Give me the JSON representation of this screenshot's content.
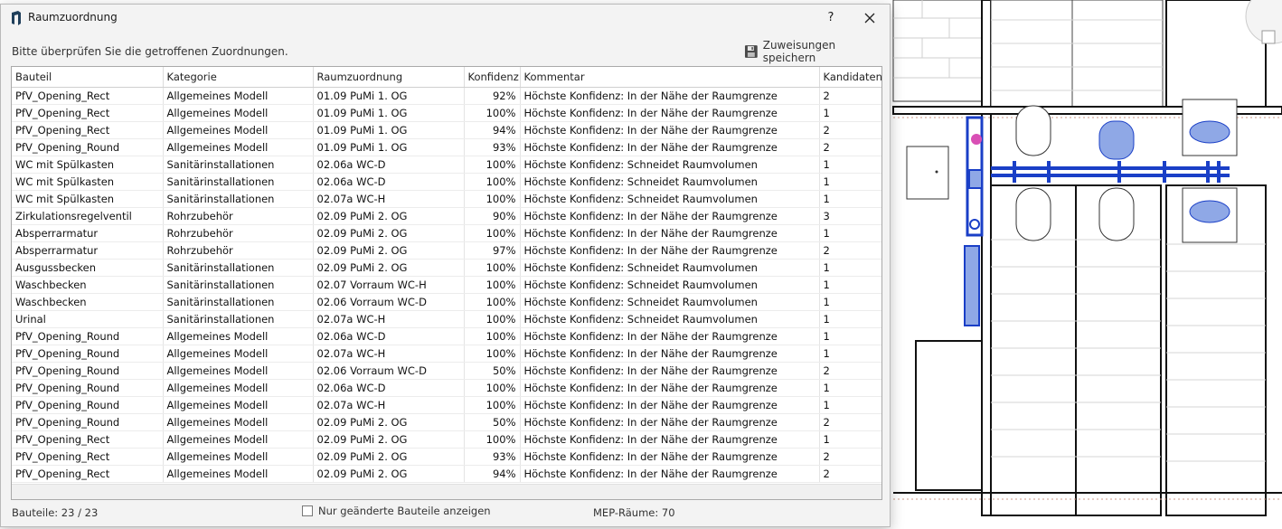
{
  "window": {
    "title": "Raumzuordnung",
    "help": "?"
  },
  "instruction": "Bitte überprüfen Sie die getroffenen Zuordnungen.",
  "save_label": "Zuweisungen speichern",
  "columns": [
    "Bauteil",
    "Kategorie",
    "Raumzuordnung",
    "Konfidenz",
    "Kommentar",
    "Kandidaten"
  ],
  "rows": [
    [
      "PfV_Opening_Rect",
      "Allgemeines Modell",
      "01.09 PuMi 1. OG",
      "92%",
      "Höchste Konfidenz: In der Nähe der Raumgrenze",
      "2"
    ],
    [
      "PfV_Opening_Rect",
      "Allgemeines Modell",
      "01.09 PuMi 1. OG",
      "100%",
      "Höchste Konfidenz: In der Nähe der Raumgrenze",
      "1"
    ],
    [
      "PfV_Opening_Rect",
      "Allgemeines Modell",
      "01.09 PuMi 1. OG",
      "94%",
      "Höchste Konfidenz: In der Nähe der Raumgrenze",
      "2"
    ],
    [
      "PfV_Opening_Round",
      "Allgemeines Modell",
      "01.09 PuMi 1. OG",
      "93%",
      "Höchste Konfidenz: In der Nähe der Raumgrenze",
      "2"
    ],
    [
      "WC mit Spülkasten",
      "Sanitärinstallationen",
      "02.06a WC-D",
      "100%",
      "Höchste Konfidenz: Schneidet Raumvolumen",
      "1"
    ],
    [
      "WC mit Spülkasten",
      "Sanitärinstallationen",
      "02.06a WC-D",
      "100%",
      "Höchste Konfidenz: Schneidet Raumvolumen",
      "1"
    ],
    [
      "WC mit Spülkasten",
      "Sanitärinstallationen",
      "02.07a WC-H",
      "100%",
      "Höchste Konfidenz: Schneidet Raumvolumen",
      "1"
    ],
    [
      "Zirkulationsregelventil",
      "Rohrzubehör",
      "02.09 PuMi 2. OG",
      "90%",
      "Höchste Konfidenz: In der Nähe der Raumgrenze",
      "3"
    ],
    [
      "Absperrarmatur",
      "Rohrzubehör",
      "02.09 PuMi 2. OG",
      "100%",
      "Höchste Konfidenz: In der Nähe der Raumgrenze",
      "1"
    ],
    [
      "Absperrarmatur",
      "Rohrzubehör",
      "02.09 PuMi 2. OG",
      "97%",
      "Höchste Konfidenz: In der Nähe der Raumgrenze",
      "2"
    ],
    [
      "Ausgussbecken",
      "Sanitärinstallationen",
      "02.09 PuMi 2. OG",
      "100%",
      "Höchste Konfidenz: Schneidet Raumvolumen",
      "1"
    ],
    [
      "Waschbecken",
      "Sanitärinstallationen",
      "02.07 Vorraum WC-H",
      "100%",
      "Höchste Konfidenz: Schneidet Raumvolumen",
      "1"
    ],
    [
      "Waschbecken",
      "Sanitärinstallationen",
      "02.06 Vorraum WC-D",
      "100%",
      "Höchste Konfidenz: Schneidet Raumvolumen",
      "1"
    ],
    [
      "Urinal",
      "Sanitärinstallationen",
      "02.07a WC-H",
      "100%",
      "Höchste Konfidenz: Schneidet Raumvolumen",
      "1"
    ],
    [
      "PfV_Opening_Round",
      "Allgemeines Modell",
      "02.06a WC-D",
      "100%",
      "Höchste Konfidenz: In der Nähe der Raumgrenze",
      "1"
    ],
    [
      "PfV_Opening_Round",
      "Allgemeines Modell",
      "02.07a WC-H",
      "100%",
      "Höchste Konfidenz: In der Nähe der Raumgrenze",
      "1"
    ],
    [
      "PfV_Opening_Round",
      "Allgemeines Modell",
      "02.06 Vorraum WC-D",
      "50%",
      "Höchste Konfidenz: In der Nähe der Raumgrenze",
      "2"
    ],
    [
      "PfV_Opening_Round",
      "Allgemeines Modell",
      "02.06a WC-D",
      "100%",
      "Höchste Konfidenz: In der Nähe der Raumgrenze",
      "1"
    ],
    [
      "PfV_Opening_Round",
      "Allgemeines Modell",
      "02.07a WC-H",
      "100%",
      "Höchste Konfidenz: In der Nähe der Raumgrenze",
      "1"
    ],
    [
      "PfV_Opening_Round",
      "Allgemeines Modell",
      "02.09 PuMi 2. OG",
      "50%",
      "Höchste Konfidenz: In der Nähe der Raumgrenze",
      "2"
    ],
    [
      "PfV_Opening_Rect",
      "Allgemeines Modell",
      "02.09 PuMi 2. OG",
      "100%",
      "Höchste Konfidenz: In der Nähe der Raumgrenze",
      "1"
    ],
    [
      "PfV_Opening_Rect",
      "Allgemeines Modell",
      "02.09 PuMi 2. OG",
      "93%",
      "Höchste Konfidenz: In der Nähe der Raumgrenze",
      "2"
    ],
    [
      "PfV_Opening_Rect",
      "Allgemeines Modell",
      "02.09 PuMi 2. OG",
      "94%",
      "Höchste Konfidenz: In der Nähe der Raumgrenze",
      "2"
    ]
  ],
  "footer": {
    "count": "Bauteile: 23 / 23",
    "filter_label": "Nur geänderte Bauteile anzeigen",
    "filter_checked": false,
    "mep": "MEP-Räume: 70"
  },
  "icons": {
    "app": "revit-app-icon",
    "save": "floppy-disk-icon",
    "close": "close-icon"
  },
  "colors": {
    "pipe": "#1a3fc7",
    "fixture": "#8fa8e6",
    "dialog_bg": "#f3f3f3",
    "marker": "#d94fb5"
  }
}
